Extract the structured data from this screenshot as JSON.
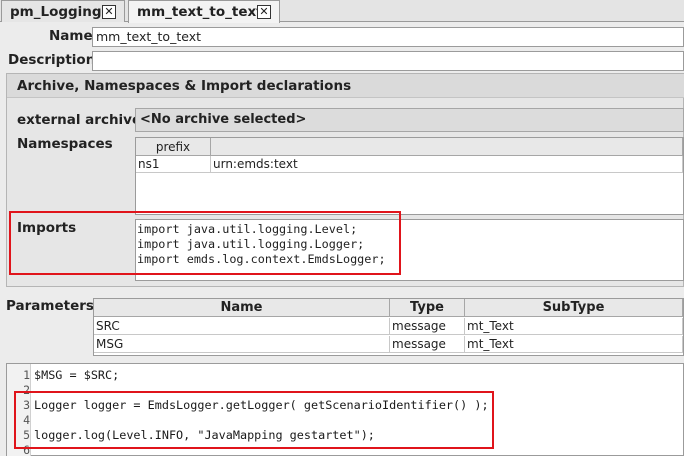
{
  "tabs": [
    {
      "label": "pm_Logging",
      "active": false
    },
    {
      "label": "mm_text_to_text",
      "active": true
    }
  ],
  "close_glyph": "✕",
  "name_label": "Name",
  "name_value": "mm_text_to_text",
  "description_label": "Description",
  "description_value": "",
  "section_title": "Archive, Namespaces & Import declarations",
  "external_archive_label": "external archive",
  "external_archive_value": "<No archive selected>",
  "namespaces_label": "Namespaces",
  "namespaces_headers": [
    "prefix",
    ""
  ],
  "namespaces_rows": [
    {
      "prefix": "ns1",
      "uri": "urn:emds:text"
    }
  ],
  "imports_label": "Imports",
  "imports_lines": [
    "import java.util.logging.Level;",
    "import java.util.logging.Logger;",
    "import emds.log.context.EmdsLogger;"
  ],
  "parameters_label": "Parameters",
  "parameters_headers": [
    "Name",
    "Type",
    "SubType"
  ],
  "parameters_rows": [
    {
      "name": "SRC",
      "type": "message",
      "subtype": "mt_Text"
    },
    {
      "name": "MSG",
      "type": "message",
      "subtype": "mt_Text"
    }
  ],
  "code_lines": [
    {
      "num": "1",
      "text": "$MSG = $SRC;"
    },
    {
      "num": "2",
      "text": ""
    },
    {
      "num": "3",
      "text": "Logger logger = EmdsLogger.getLogger( getScenarioIdentifier() );"
    },
    {
      "num": "4",
      "text": ""
    },
    {
      "num": "5",
      "text": "logger.log(Level.INFO, \"JavaMapping gestartet\");"
    },
    {
      "num": "6",
      "text": ""
    }
  ],
  "colors": {
    "highlight_box": "#e0141b",
    "variable": "#1a1a9a"
  }
}
